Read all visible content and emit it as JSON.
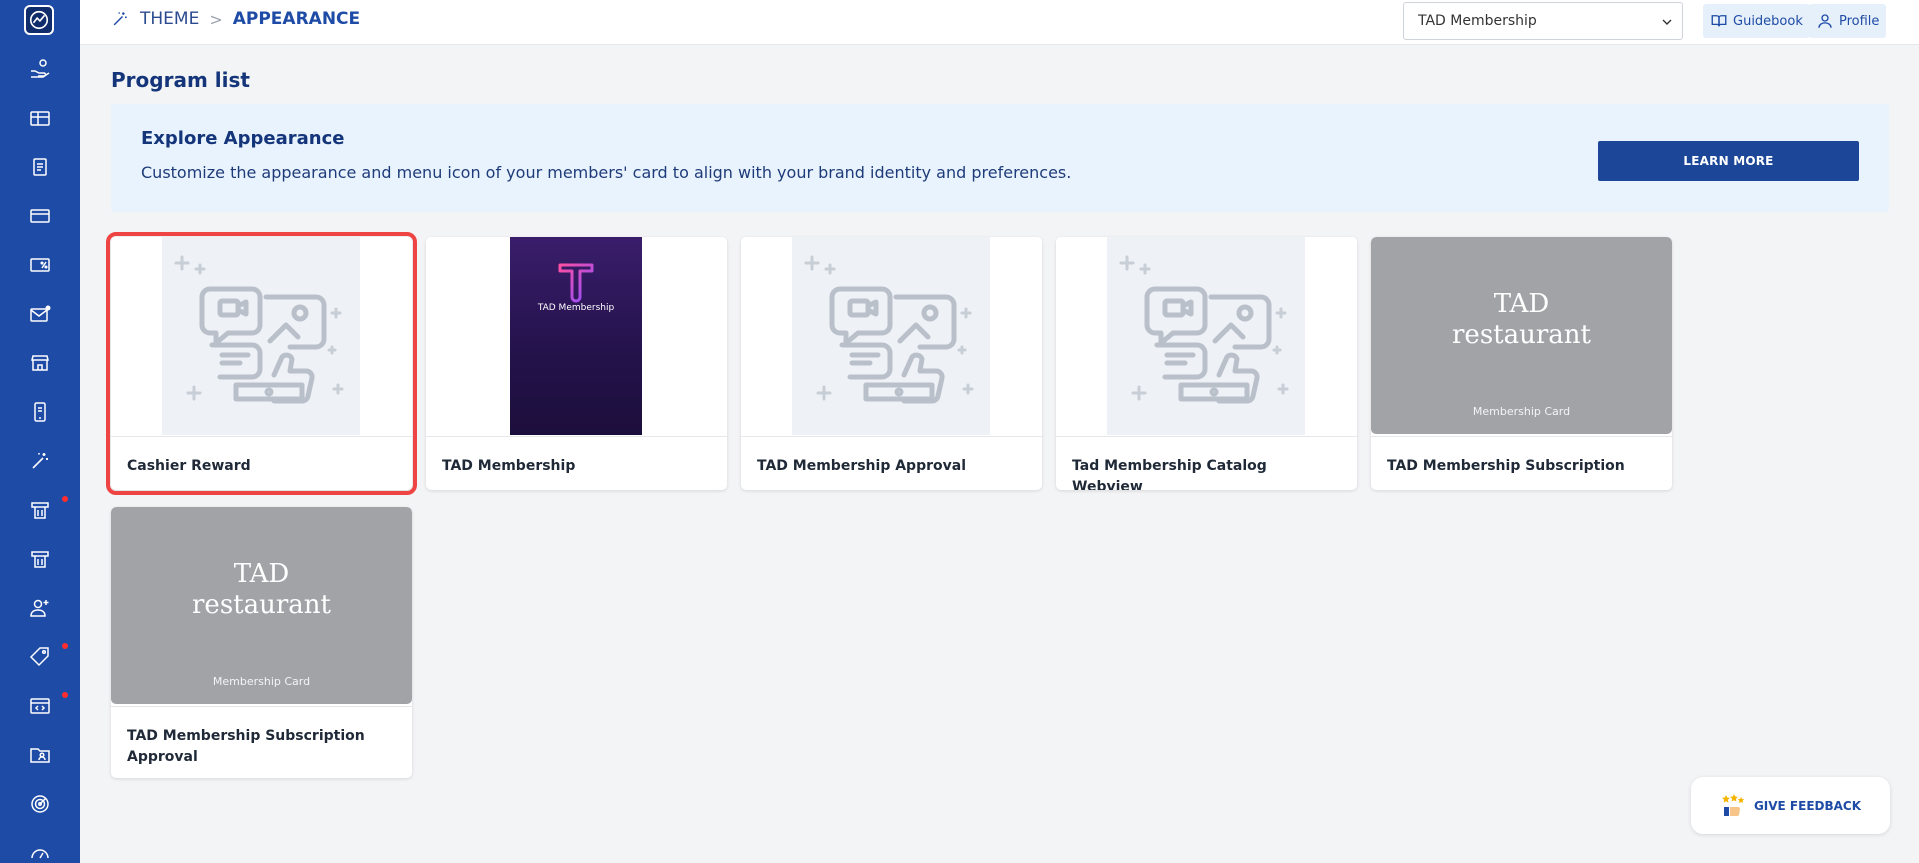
{
  "breadcrumb": {
    "level1": "THEME",
    "separator": ">",
    "level2": "APPEARANCE"
  },
  "header": {
    "program_select_value": "TAD Membership",
    "guidebook_label": "Guidebook",
    "profile_label": "Profile"
  },
  "page": {
    "title": "Program list"
  },
  "banner": {
    "title": "Explore Appearance",
    "description": "Customize the appearance and menu icon of your members' card to align with your brand identity and preferences.",
    "button_label": "LEARN MORE"
  },
  "cards": [
    {
      "name": "Cashier Reward",
      "thumb": "placeholder",
      "selected": true
    },
    {
      "name": "TAD Membership",
      "thumb": "app",
      "app_label": "TAD Membership"
    },
    {
      "name": "TAD Membership Approval",
      "thumb": "placeholder"
    },
    {
      "name": "Tad Membership Catalog Webview",
      "thumb": "placeholder"
    },
    {
      "name": "TAD Membership Subscription",
      "thumb": "grey",
      "grey_title_1": "TAD",
      "grey_title_2": "restaurant",
      "grey_sub": "Membership Card"
    },
    {
      "name": "TAD Membership Subscription Approval",
      "thumb": "grey",
      "grey_title_1": "TAD",
      "grey_title_2": "restaurant",
      "grey_sub": "Membership Card"
    }
  ],
  "feedback": {
    "label": "GIVE FEEDBACK"
  },
  "sidebar": {
    "icons": [
      "hand-coin-icon",
      "gift-card-icon",
      "document-icon",
      "credit-card-icon",
      "discount-card-icon",
      "mail-notification-icon",
      "store-icon",
      "mobile-app-icon",
      "magic-wand-icon",
      "voucher-icon",
      "voucher-alt-icon",
      "user-add-icon",
      "tag-icon",
      "code-window-icon",
      "folder-user-icon",
      "target-icon",
      "gauge-icon"
    ],
    "dots": [
      false,
      false,
      false,
      false,
      false,
      false,
      false,
      false,
      false,
      true,
      false,
      false,
      true,
      true,
      false,
      false,
      false
    ]
  },
  "colors": {
    "sidebar": "#1e4ba6",
    "accent": "#1c4697",
    "selected_outline": "#ef4444",
    "banner_bg": "#e8f3fd"
  }
}
